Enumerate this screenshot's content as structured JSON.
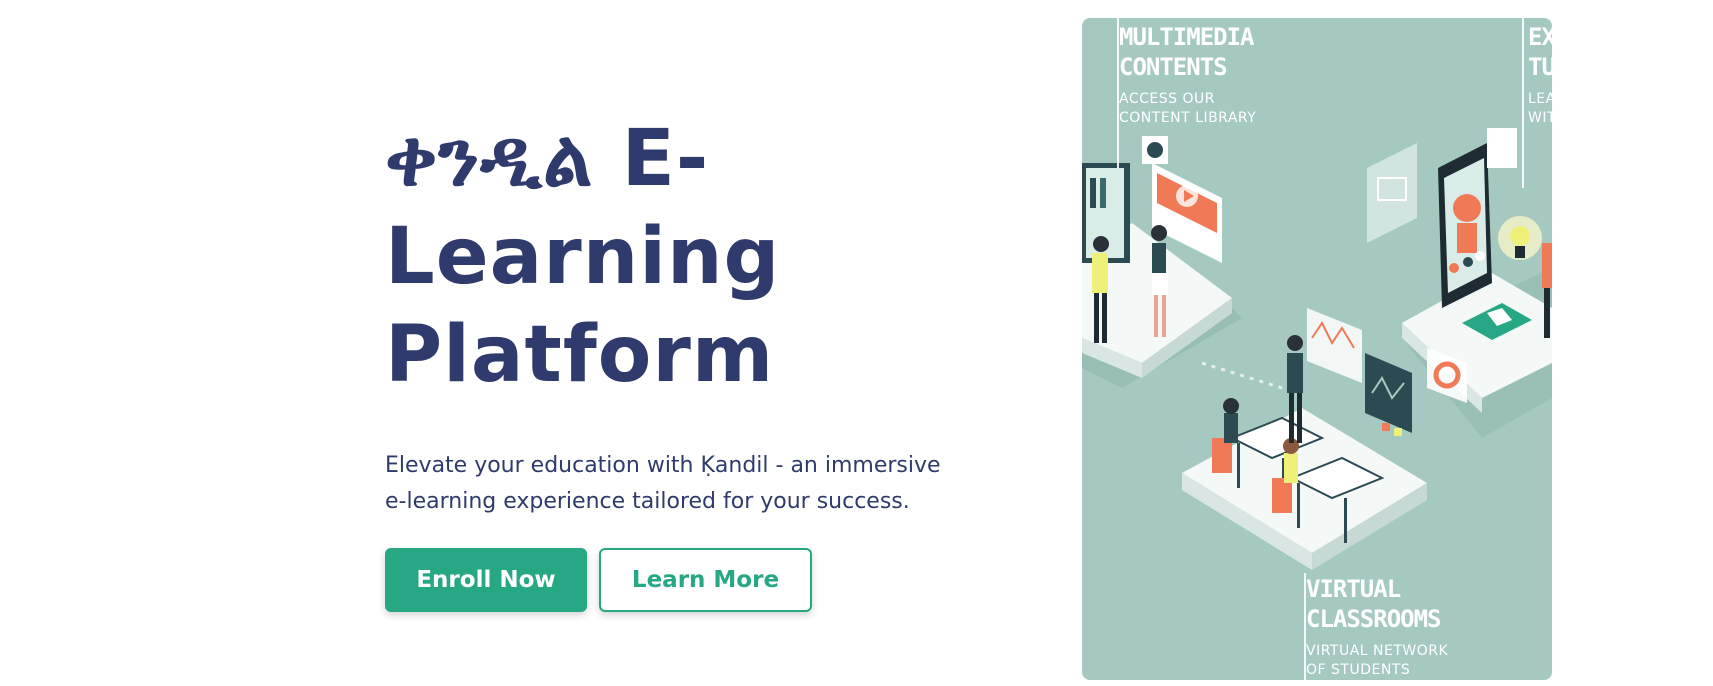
{
  "hero": {
    "title_line1": "ቀንዲል E-",
    "title_line2": "Learning",
    "title_line3": "Platform",
    "description": "Elevate your education with Ḳandil - an immersive e-learning experience tailored for your success.",
    "enroll_button": "Enroll Now",
    "learn_more_button": "Learn More"
  },
  "illustration": {
    "panel1_heading_line1": "MULTIMEDIA",
    "panel1_heading_line2": "CONTENTS",
    "panel1_sub_line1": "ACCESS OUR",
    "panel1_sub_line2": "CONTENT LIBRARY",
    "panel2_heading_line1": "EX",
    "panel2_heading_line2": "TU",
    "panel2_sub_line1": "LEA",
    "panel2_sub_line2": "WIT",
    "panel3_heading_line1": "VIRTUAL",
    "panel3_heading_line2": "CLASSROOMS",
    "panel3_sub_line1": "VIRTUAL NETWORK",
    "panel3_sub_line2": "OF STUDENTS"
  },
  "colors": {
    "brand_navy": "#2f3b6d",
    "brand_green": "#27a884",
    "illustration_bg": "#a5c9c1",
    "accent_orange": "#f07a55"
  }
}
